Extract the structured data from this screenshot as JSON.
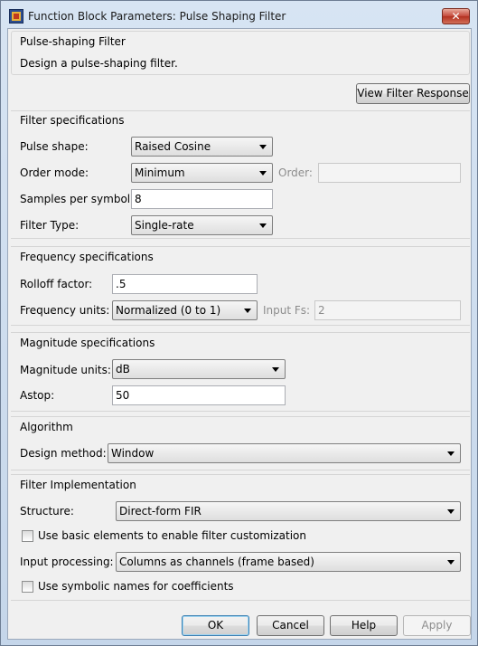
{
  "window": {
    "title": "Function Block Parameters: Pulse Shaping Filter",
    "close_label": "✕"
  },
  "header": {
    "title": "Pulse-shaping Filter",
    "description": "Design a pulse-shaping filter."
  },
  "view_filter_response": "View Filter Response",
  "filter_specs": {
    "title": "Filter specifications",
    "pulse_shape_label": "Pulse shape:",
    "pulse_shape_value": "Raised Cosine",
    "order_mode_label": "Order mode:",
    "order_mode_value": "Minimum",
    "order_label": "Order:",
    "order_value": "",
    "samples_label": "Samples per symbol",
    "samples_value": "8",
    "filter_type_label": "Filter Type:",
    "filter_type_value": "Single-rate"
  },
  "frequency_specs": {
    "title": "Frequency specifications",
    "rolloff_label": "Rolloff factor:",
    "rolloff_value": ".5",
    "units_label": "Frequency units:",
    "units_value": "Normalized (0 to 1)",
    "input_fs_label": "Input Fs:",
    "input_fs_value": "2"
  },
  "magnitude_specs": {
    "title": "Magnitude specifications",
    "units_label": "Magnitude units:",
    "units_value": "dB",
    "astop_label": "Astop:",
    "astop_value": "50"
  },
  "algorithm": {
    "title": "Algorithm",
    "method_label": "Design method:",
    "method_value": "Window"
  },
  "implementation": {
    "title": "Filter Implementation",
    "structure_label": "Structure:",
    "structure_value": "Direct-form FIR",
    "basic_elements_label": "Use basic elements to enable filter customization",
    "basic_elements_checked": false,
    "input_processing_label": "Input processing:",
    "input_processing_value": "Columns as channels (frame based)",
    "symbolic_names_label": "Use symbolic names for coefficients",
    "symbolic_names_checked": false
  },
  "buttons": {
    "ok": "OK",
    "cancel": "Cancel",
    "help": "Help",
    "apply": "Apply"
  }
}
